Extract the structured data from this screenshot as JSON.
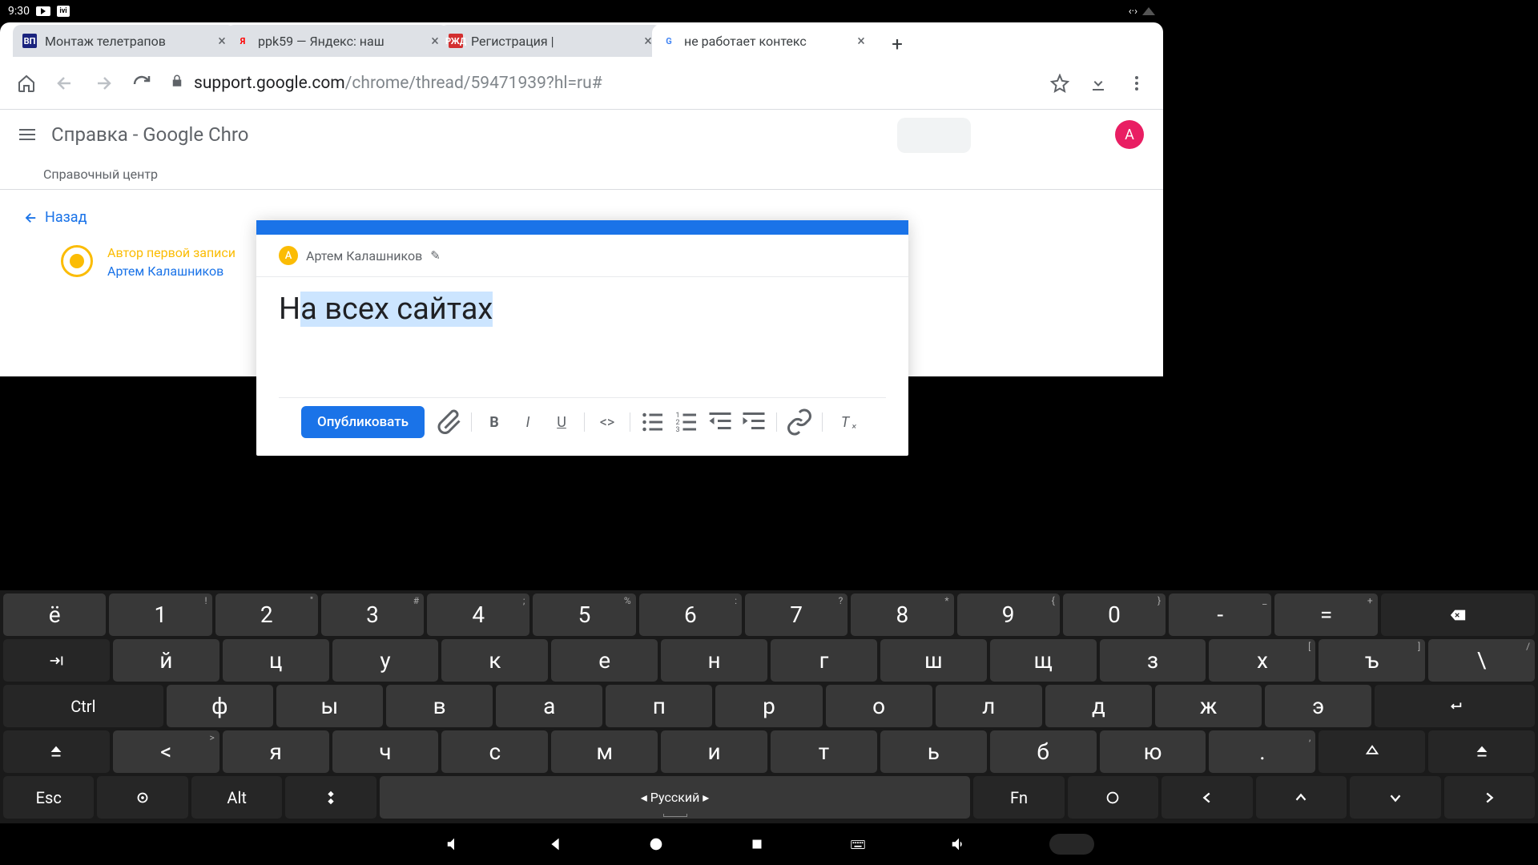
{
  "status": {
    "time": "9:30",
    "ivi_text": "ivi"
  },
  "tabs": [
    {
      "favicon_text": "ВП",
      "favicon_bg": "#1a237e",
      "favicon_color": "#fff",
      "title": "Монтаж телетрапов"
    },
    {
      "favicon_text": "Я",
      "favicon_bg": "transparent",
      "favicon_color": "#f00",
      "title": "ppk59 — Яндекс: наш"
    },
    {
      "favicon_text": "РЖД",
      "favicon_bg": "#d32f2f",
      "favicon_color": "#fff",
      "title": "Регистрация |"
    },
    {
      "favicon_text": "G",
      "favicon_bg": "transparent",
      "favicon_color": "#4285f4",
      "title": "не работает контекс"
    }
  ],
  "url": {
    "host": "support.google.com",
    "path": "/chrome/thread/59471939?hl=ru#"
  },
  "page": {
    "app_title": "Справка - Google Chro",
    "subnav": "Справочный центр",
    "back": "Назад",
    "author_tag": "Автор первой записи",
    "author_name": "Артем Калашников",
    "avatar_letter": "А"
  },
  "editor": {
    "author": "Артем Калашников",
    "avatar_letter": "A",
    "text_prefix": "Н",
    "text_selected": "а всех сайтах",
    "publish": "Опубликовать"
  },
  "keyboard": {
    "row1": [
      {
        "k": "ё"
      },
      {
        "k": "1",
        "s": "!"
      },
      {
        "k": "2",
        "s": "\""
      },
      {
        "k": "3",
        "s": "#"
      },
      {
        "k": "4",
        "s": ";"
      },
      {
        "k": "5",
        "s": "%"
      },
      {
        "k": "6",
        "s": ":"
      },
      {
        "k": "7",
        "s": "?"
      },
      {
        "k": "8",
        "s": "*"
      },
      {
        "k": "9",
        "s": "{"
      },
      {
        "k": "0",
        "s": "}"
      },
      {
        "k": "-",
        "s": "_"
      },
      {
        "k": "=",
        "s": "+"
      }
    ],
    "row2": [
      {
        "k": "й"
      },
      {
        "k": "ц"
      },
      {
        "k": "у"
      },
      {
        "k": "к"
      },
      {
        "k": "е"
      },
      {
        "k": "н"
      },
      {
        "k": "г"
      },
      {
        "k": "ш"
      },
      {
        "k": "щ"
      },
      {
        "k": "з"
      },
      {
        "k": "х",
        "s": "["
      },
      {
        "k": "ъ",
        "s": "]"
      },
      {
        "k": "\\",
        "s": "/"
      }
    ],
    "row3": [
      {
        "k": "ф"
      },
      {
        "k": "ы"
      },
      {
        "k": "в"
      },
      {
        "k": "а"
      },
      {
        "k": "п"
      },
      {
        "k": "р"
      },
      {
        "k": "о"
      },
      {
        "k": "л"
      },
      {
        "k": "д"
      },
      {
        "k": "ж"
      },
      {
        "k": "э"
      }
    ],
    "row4": [
      {
        "k": "я"
      },
      {
        "k": "ч"
      },
      {
        "k": "с"
      },
      {
        "k": "м"
      },
      {
        "k": "и"
      },
      {
        "k": "т"
      },
      {
        "k": "ь"
      },
      {
        "k": "б"
      },
      {
        "k": "ю"
      },
      {
        "k": ".",
        "s": ","
      }
    ],
    "ctrl": "Ctrl",
    "alt": "Alt",
    "esc": "Esc",
    "fn": "Fn",
    "lang": "Русский",
    "shift_sub": "<",
    "shift_sub2": ">"
  }
}
